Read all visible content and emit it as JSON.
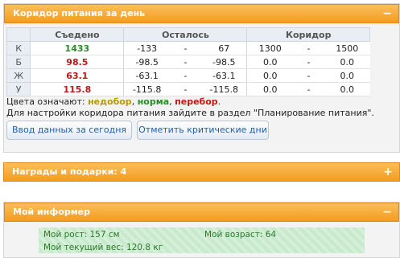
{
  "panel_corridor": {
    "title": "Коридор питания за день",
    "toggle": "−",
    "table": {
      "headers": [
        "",
        "Съедено",
        "Осталось",
        "Коридор"
      ],
      "rows": [
        {
          "label": "К",
          "eaten": "1433",
          "left_min": "-133",
          "left_dash": "-",
          "left_max": "67",
          "cor_min": "1300",
          "cor_dash": "-",
          "cor_max": "1500"
        },
        {
          "label": "Б",
          "eaten": "98.5",
          "left_min": "-98.5",
          "left_dash": "-",
          "left_max": "-98.5",
          "cor_min": "0.0",
          "cor_dash": "-",
          "cor_max": "0.0"
        },
        {
          "label": "Ж",
          "eaten": "63.1",
          "left_min": "-63.1",
          "left_dash": "-",
          "left_max": "-63.1",
          "cor_min": "0.0",
          "cor_dash": "-",
          "cor_max": "0.0"
        },
        {
          "label": "У",
          "eaten": "115.8",
          "left_min": "-115.8",
          "left_dash": "-",
          "left_max": "-115.8",
          "cor_min": "0.0",
          "cor_dash": "-",
          "cor_max": "0.0"
        }
      ]
    },
    "legend": {
      "prefix": "Цвета означают:",
      "under": "недобор",
      "norm": "норма",
      "over": "перебор",
      "comma": ",",
      "dot": "."
    },
    "note": "Для настройки коридора питания зайдите в раздел \"Планирование питания\".",
    "btn_today": "Ввод данных за сегодня",
    "btn_critical": "Отметить критические дни"
  },
  "panel_awards": {
    "title": "Награды и подарки: 4",
    "toggle": "+"
  },
  "panel_informer": {
    "title": "Мой информер",
    "toggle": "−",
    "height": "Мой рост: 157 см",
    "age": "Мой возраст: 64",
    "weight": "Мой текущий вес: 120.8 кг"
  },
  "colors": {
    "header": "#f39c1f",
    "ok": "#2a8c2a",
    "over": "#c31616",
    "under": "#b89b00"
  }
}
